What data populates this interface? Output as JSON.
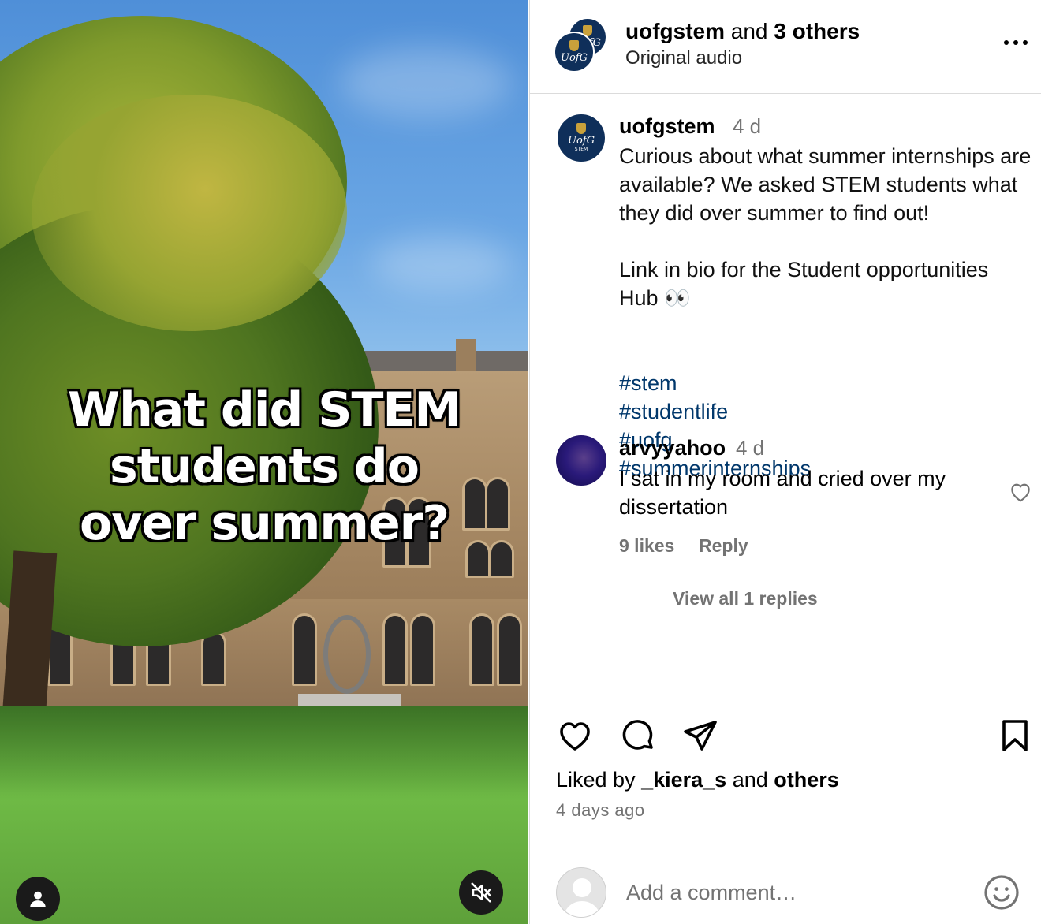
{
  "media": {
    "overlay_lines": [
      "What did STEM",
      "students do",
      "over summer?"
    ],
    "user_button_icon": "person-icon",
    "mute_button_icon": "speaker-muted-icon"
  },
  "header": {
    "avatar_logo": "UofG",
    "avatar_sub": "STEM",
    "username": "uofgstem",
    "joiner": "and",
    "others": "3 others",
    "audio": "Original audio",
    "more_icon": "more-horizontal-icon"
  },
  "caption": {
    "username": "uofgstem",
    "time": "4 d",
    "paragraph1": "Curious about what summer internships are available? We asked STEM students what they did over summer to find out!",
    "paragraph2": "Link in bio for the Student opportunities Hub 👀",
    "hashtags": [
      "#stem",
      "#studentlife",
      "#uofg",
      "#summerinternships"
    ]
  },
  "comment": {
    "username": "arvyyahoo",
    "time": "4 d",
    "text": "I sat in my room and cried over my dissertation",
    "likes": "9 likes",
    "reply": "Reply",
    "view_replies": "View all 1 replies"
  },
  "actions": {
    "liked_by_prefix": "Liked by",
    "liked_by_user": "_kiera_s",
    "liked_by_joiner": "and",
    "liked_by_others": "others",
    "time": "4 days ago",
    "icons": [
      "heart-icon",
      "comment-icon",
      "share-icon",
      "bookmark-icon"
    ]
  },
  "composer": {
    "placeholder": "Add a comment…",
    "emoji_icon": "smiley-icon"
  }
}
